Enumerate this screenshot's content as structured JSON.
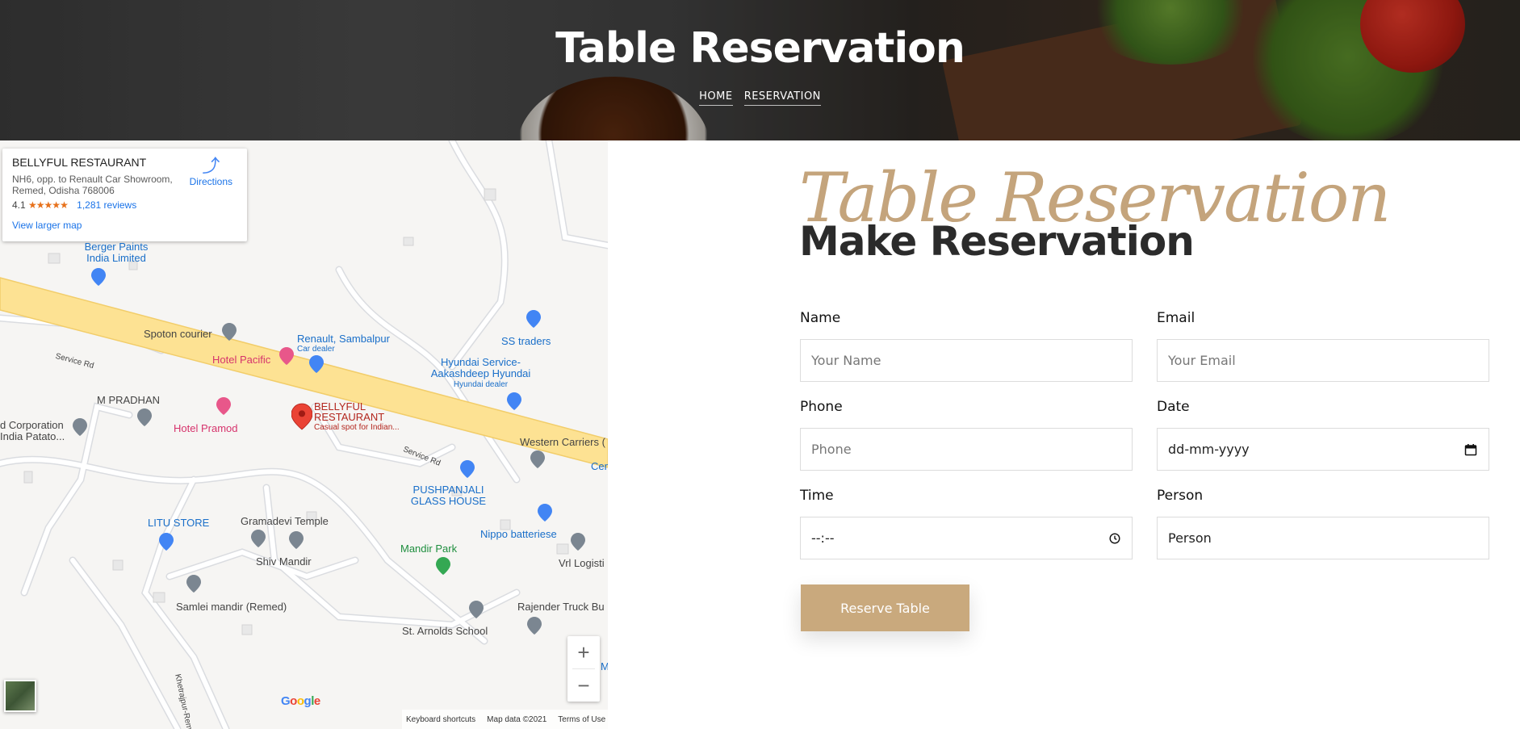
{
  "hero": {
    "title": "Table Reservation",
    "breadcrumb": [
      "HOME",
      "RESERVATION"
    ]
  },
  "map": {
    "place_name": "BELLYFUL RESTAURANT",
    "address": "NH6, opp. to Renault Car Showroom, Remed, Odisha 768006",
    "rating": "4.1",
    "stars": "★★★★★",
    "reviews": "1,281 reviews",
    "directions": "Directions",
    "view_larger": "View larger map",
    "pois": {
      "berger": "Berger Paints India Limited",
      "spoton": "Spoton courier",
      "renault": "Renault, Sambalpur",
      "renault_sub": "Car dealer",
      "hotel_pacific": "Hotel Pacific",
      "ss_traders": "SS traders",
      "hyundai": "Hyundai Service-Aakashdeep Hyundai",
      "hyundai_sub": "Hyundai dealer",
      "m_pradhan": "M PRADHAN",
      "hotel_pramod": "Hotel Pramod",
      "bellyful": "BELLYFUL RESTAURANT",
      "bellyful_sub": "Casual spot for Indian...",
      "corporation": "d Corporation India Patato...",
      "western": "Western Carriers (",
      "cen": "Cen",
      "pushpanjali": "PUSHPANJALI GLASS HOUSE",
      "litu": "LITU STORE",
      "gramadevi": "Gramadevi Temple",
      "shiv": "Shiv Mandir",
      "mandir_park": "Mandir Park",
      "nippo": "Nippo batteriese",
      "vrl": "Vrl Logisti",
      "samlei": "Samlei mandir (Remed)",
      "rajender": "Rajender Truck Bu",
      "st_arnolds": "St. Arnolds School",
      "m_edge": "M"
    },
    "roads": {
      "service1": "Service Rd",
      "service2": "Service Rd",
      "khetrajpur": "Khetrajpur-Remed Rd"
    },
    "zoom_in": "+",
    "zoom_out": "−",
    "google": [
      "G",
      "o",
      "o",
      "g",
      "l",
      "e"
    ],
    "footer": [
      "Keyboard shortcuts",
      "Map data ©2021",
      "Terms of Use"
    ]
  },
  "form": {
    "script_title": "Table Reservation",
    "heading": "Make Reservation",
    "name_label": "Name",
    "name_placeholder": "Your Name",
    "email_label": "Email",
    "email_placeholder": "Your Email",
    "phone_label": "Phone",
    "phone_placeholder": "Phone",
    "date_label": "Date",
    "date_value": "dd-mm-yyyy",
    "time_label": "Time",
    "time_value": "--:--",
    "person_label": "Person",
    "person_value": "Person",
    "submit": "Reserve Table"
  }
}
